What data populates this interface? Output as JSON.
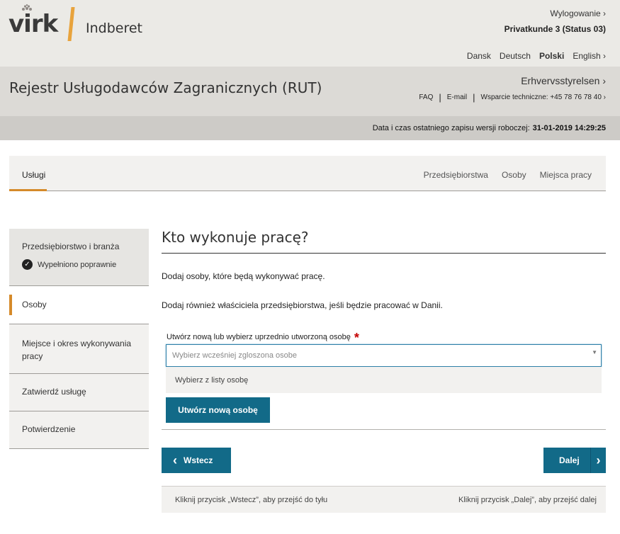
{
  "header": {
    "logo_text": "virk",
    "app_name": "Indberet",
    "logout": "Wylogowanie ›",
    "user": "Privatkunde 3 (Status 03)",
    "languages": [
      "Dansk",
      "Deutsch",
      "Polski",
      "English ›"
    ],
    "active_language": "Polski"
  },
  "title_band": {
    "title": "Rejestr Usługodawców Zagranicznych (RUT)",
    "agency": "Erhvervsstyrelsen ›",
    "faq": "FAQ",
    "email": "E-mail",
    "support": "Wsparcie techniczne: +45 78 76 78 40 ›"
  },
  "save_band": {
    "label": "Data i czas ostatniego zapisu wersji roboczej:",
    "value": "31-01-2019 14:29:25"
  },
  "tabs": {
    "active": "Usługi",
    "items": [
      "Przedsiębiorstwa",
      "Osoby",
      "Miejsca pracy"
    ]
  },
  "sidebar": {
    "items": [
      {
        "label": "Przedsiębiorstwo i branża",
        "status": "Wypełniono poprawnie"
      },
      {
        "label": "Osoby"
      },
      {
        "label": "Miejsce i okres wykonywania pracy"
      },
      {
        "label": "Zatwierdź usługę"
      },
      {
        "label": "Potwierdzenie"
      }
    ]
  },
  "main": {
    "title": "Kto wykonuje pracę?",
    "p1": "Dodaj osoby, które będą wykonywać pracę.",
    "p2": "Dodaj również właściciela przedsiębiorstwa, jeśli będzie pracować w Danii.",
    "field_label": "Utwórz nową lub wybierz uprzednio utworzoną osobę",
    "required_mark": "*",
    "select_placeholder": "Wybierz wcześniej zgloszona osobe",
    "dropdown_option": "Wybierz z listy osobę",
    "create_button": "Utwórz nową osobę",
    "back_button": "Wstecz",
    "next_button": "Dalej",
    "hint_back": "Kliknij przycisk „Wstecz”, aby przejść do tyłu",
    "hint_next": "Kliknij przycisk „Dalej”, aby przejść dalej"
  },
  "colors": {
    "accent_orange": "#d58a2a",
    "button_blue": "#126a88",
    "required_red": "#c40000"
  }
}
